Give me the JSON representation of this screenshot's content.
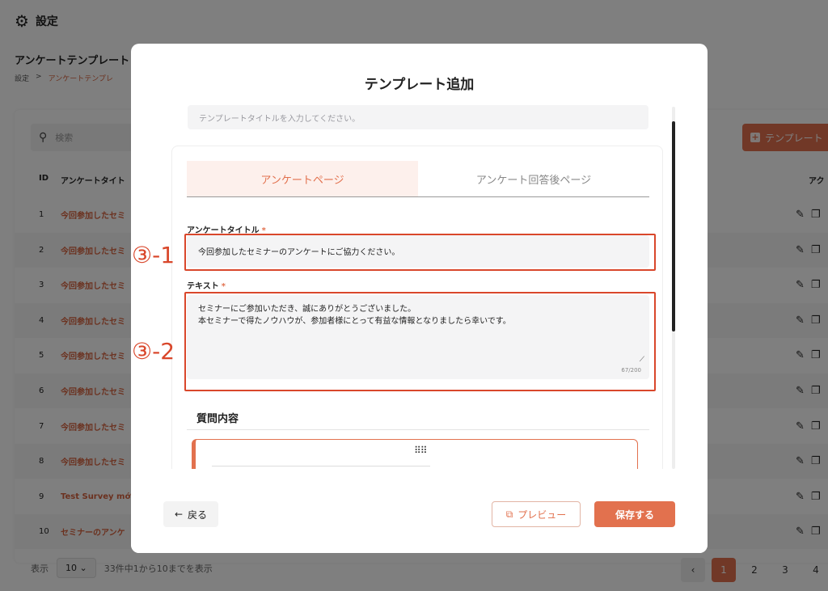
{
  "topbar": {
    "title": "設定",
    "gear_icon": "gear-icon"
  },
  "page": {
    "heading": "アンケートテンプレート",
    "breadcrumb": {
      "root": "設定",
      "sep": ">",
      "current": "アンケートテンプレ"
    }
  },
  "list": {
    "search_placeholder": "検索",
    "add_button_label": "テンプレート",
    "columns": {
      "id": "ID",
      "title": "アンケートタイト",
      "actions": "アク"
    },
    "rows": [
      {
        "id": "1",
        "title": "今回参加したセミ"
      },
      {
        "id": "2",
        "title": "今回参加したセミ"
      },
      {
        "id": "3",
        "title": "今回参加したセミ"
      },
      {
        "id": "4",
        "title": "今回参加したセミ"
      },
      {
        "id": "5",
        "title": "今回参加したセミ"
      },
      {
        "id": "6",
        "title": "今回参加したセミ"
      },
      {
        "id": "7",
        "title": "今回参加したセミ"
      },
      {
        "id": "8",
        "title": "今回参加したセミ"
      },
      {
        "id": "9",
        "title": "Test Survey mới"
      },
      {
        "id": "10",
        "title": "セミナーのアンケ"
      }
    ],
    "footer": {
      "show_label": "表示",
      "page_size": "10",
      "summary": "33件中1から10までを表示"
    },
    "pager": {
      "prev": "‹",
      "pages": [
        "1",
        "2",
        "3",
        "4"
      ],
      "active": "1"
    }
  },
  "modal": {
    "title": "テンプレート追加",
    "template_title_placeholder": "テンプレートタイトルを入力してください。",
    "tabs": [
      "アンケートページ",
      "アンケート回答後ページ"
    ],
    "active_tab": 0,
    "survey_title_label": "アンケートタイトル",
    "survey_title_value": "今回参加したセミナーのアンケートにご協力ください。",
    "text_label": "テキスト",
    "text_line1": "セミナーにご参加いただき、誠にありがとうございました。",
    "text_line2": "本セミナーで得たノウハウが、参加者様にとって有益な情報となりましたら幸いです。",
    "text_counter": "67/200",
    "required_mark": "*",
    "questions_heading": "質問内容",
    "back_label": "戻る",
    "preview_label": "プレビュー",
    "save_label": "保存する"
  },
  "annotations": {
    "label1": "③-1",
    "label2": "③-2"
  },
  "colors": {
    "accent": "#e2714e",
    "annotation": "#d9472b"
  }
}
